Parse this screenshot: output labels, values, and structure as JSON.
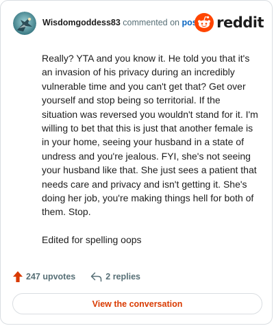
{
  "header": {
    "username": "Wisdomgoddess83",
    "action": "commented on",
    "post_link": "post",
    "brand": "reddit"
  },
  "comment": {
    "paragraphs": [
      "Really? YTA and you know it. He told you that it's an invasion of his privacy during an incredibly vulnerable time and you can't get that? Get over yourself and stop being so territorial. If the situation was reversed you wouldn't stand for it. I'm willing to bet that this is just that another female is in your home, seeing your husband in a state of undress and you're jealous. FYI, she's not seeing your husband like that. She just sees a patient that needs care and privacy and isn't getting it. She's doing her job, you're making things hell for both of them. Stop.",
      "Edited for spelling oops"
    ]
  },
  "stats": {
    "upvotes": "247 upvotes",
    "replies": "2 replies"
  },
  "cta": {
    "label": "View the conversation"
  },
  "icons": {
    "avatar": "user-avatar",
    "brand_logo": "reddit-snoo-icon",
    "upvote": "upvote-arrow-icon",
    "reply": "reply-arrow-icon"
  },
  "colors": {
    "brand_orange": "#ff4500",
    "upvote": "#d93a00",
    "link_blue": "#0a66c2",
    "muted_text": "#576f76",
    "border": "#d9dde1"
  }
}
